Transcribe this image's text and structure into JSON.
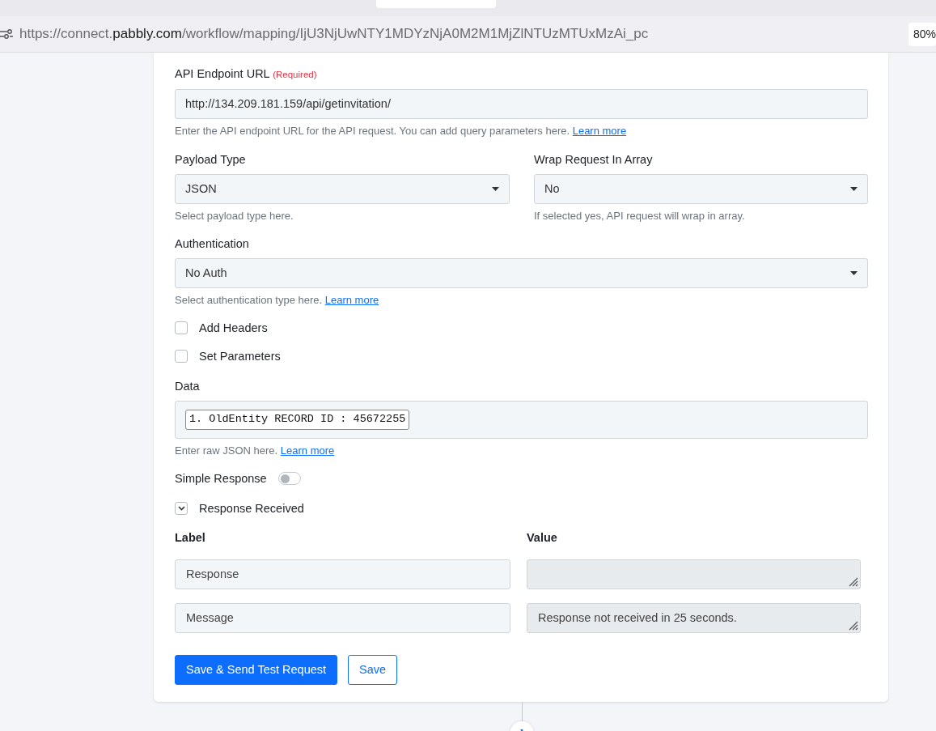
{
  "browser": {
    "url": {
      "prefix": "https://connect.",
      "domain": "pabbly.com",
      "path": "/workflow/mapping/IjU3NjUwNTY1MDYzNjA0M2M1MjZlNTUzMTUxMzAi_pc"
    },
    "zoom": "80%"
  },
  "form": {
    "endpoint": {
      "label": "API Endpoint URL",
      "required_note": "(Required)",
      "value": "http://134.209.181.159/api/getinvitation/",
      "help": "Enter the API endpoint URL for the API request. You can add query parameters here.",
      "help_link": "Learn more"
    },
    "payload_type": {
      "label": "Payload Type",
      "value": "JSON",
      "help": "Select payload type here."
    },
    "wrap_request": {
      "label": "Wrap Request In Array",
      "value": "No",
      "help": "If selected yes, API request will wrap in array."
    },
    "authentication": {
      "label": "Authentication",
      "value": "No Auth",
      "help": "Select authentication type here.",
      "help_link": "Learn more"
    },
    "options": [
      {
        "label": "Add Headers",
        "checked": false
      },
      {
        "label": "Set Parameters",
        "checked": false
      }
    ],
    "data": {
      "label": "Data",
      "token": "1. OldEntity RECORD ID : 45672255",
      "help": "Enter raw JSON here.",
      "help_link": "Learn more"
    },
    "simple_response": {
      "label": "Simple Response",
      "on": false
    },
    "response_received": {
      "label": "Response Received",
      "expanded": true
    },
    "response_table": {
      "columns": [
        "Label",
        "Value"
      ],
      "rows": [
        {
          "label": "Response"
        },
        {
          "label": "Message",
          "value": "Response not received in 25 seconds."
        }
      ]
    },
    "buttons": [
      {
        "label": "Save & Send Test Request",
        "kind": "primary"
      },
      {
        "label": "Save",
        "kind": "outline"
      }
    ]
  }
}
